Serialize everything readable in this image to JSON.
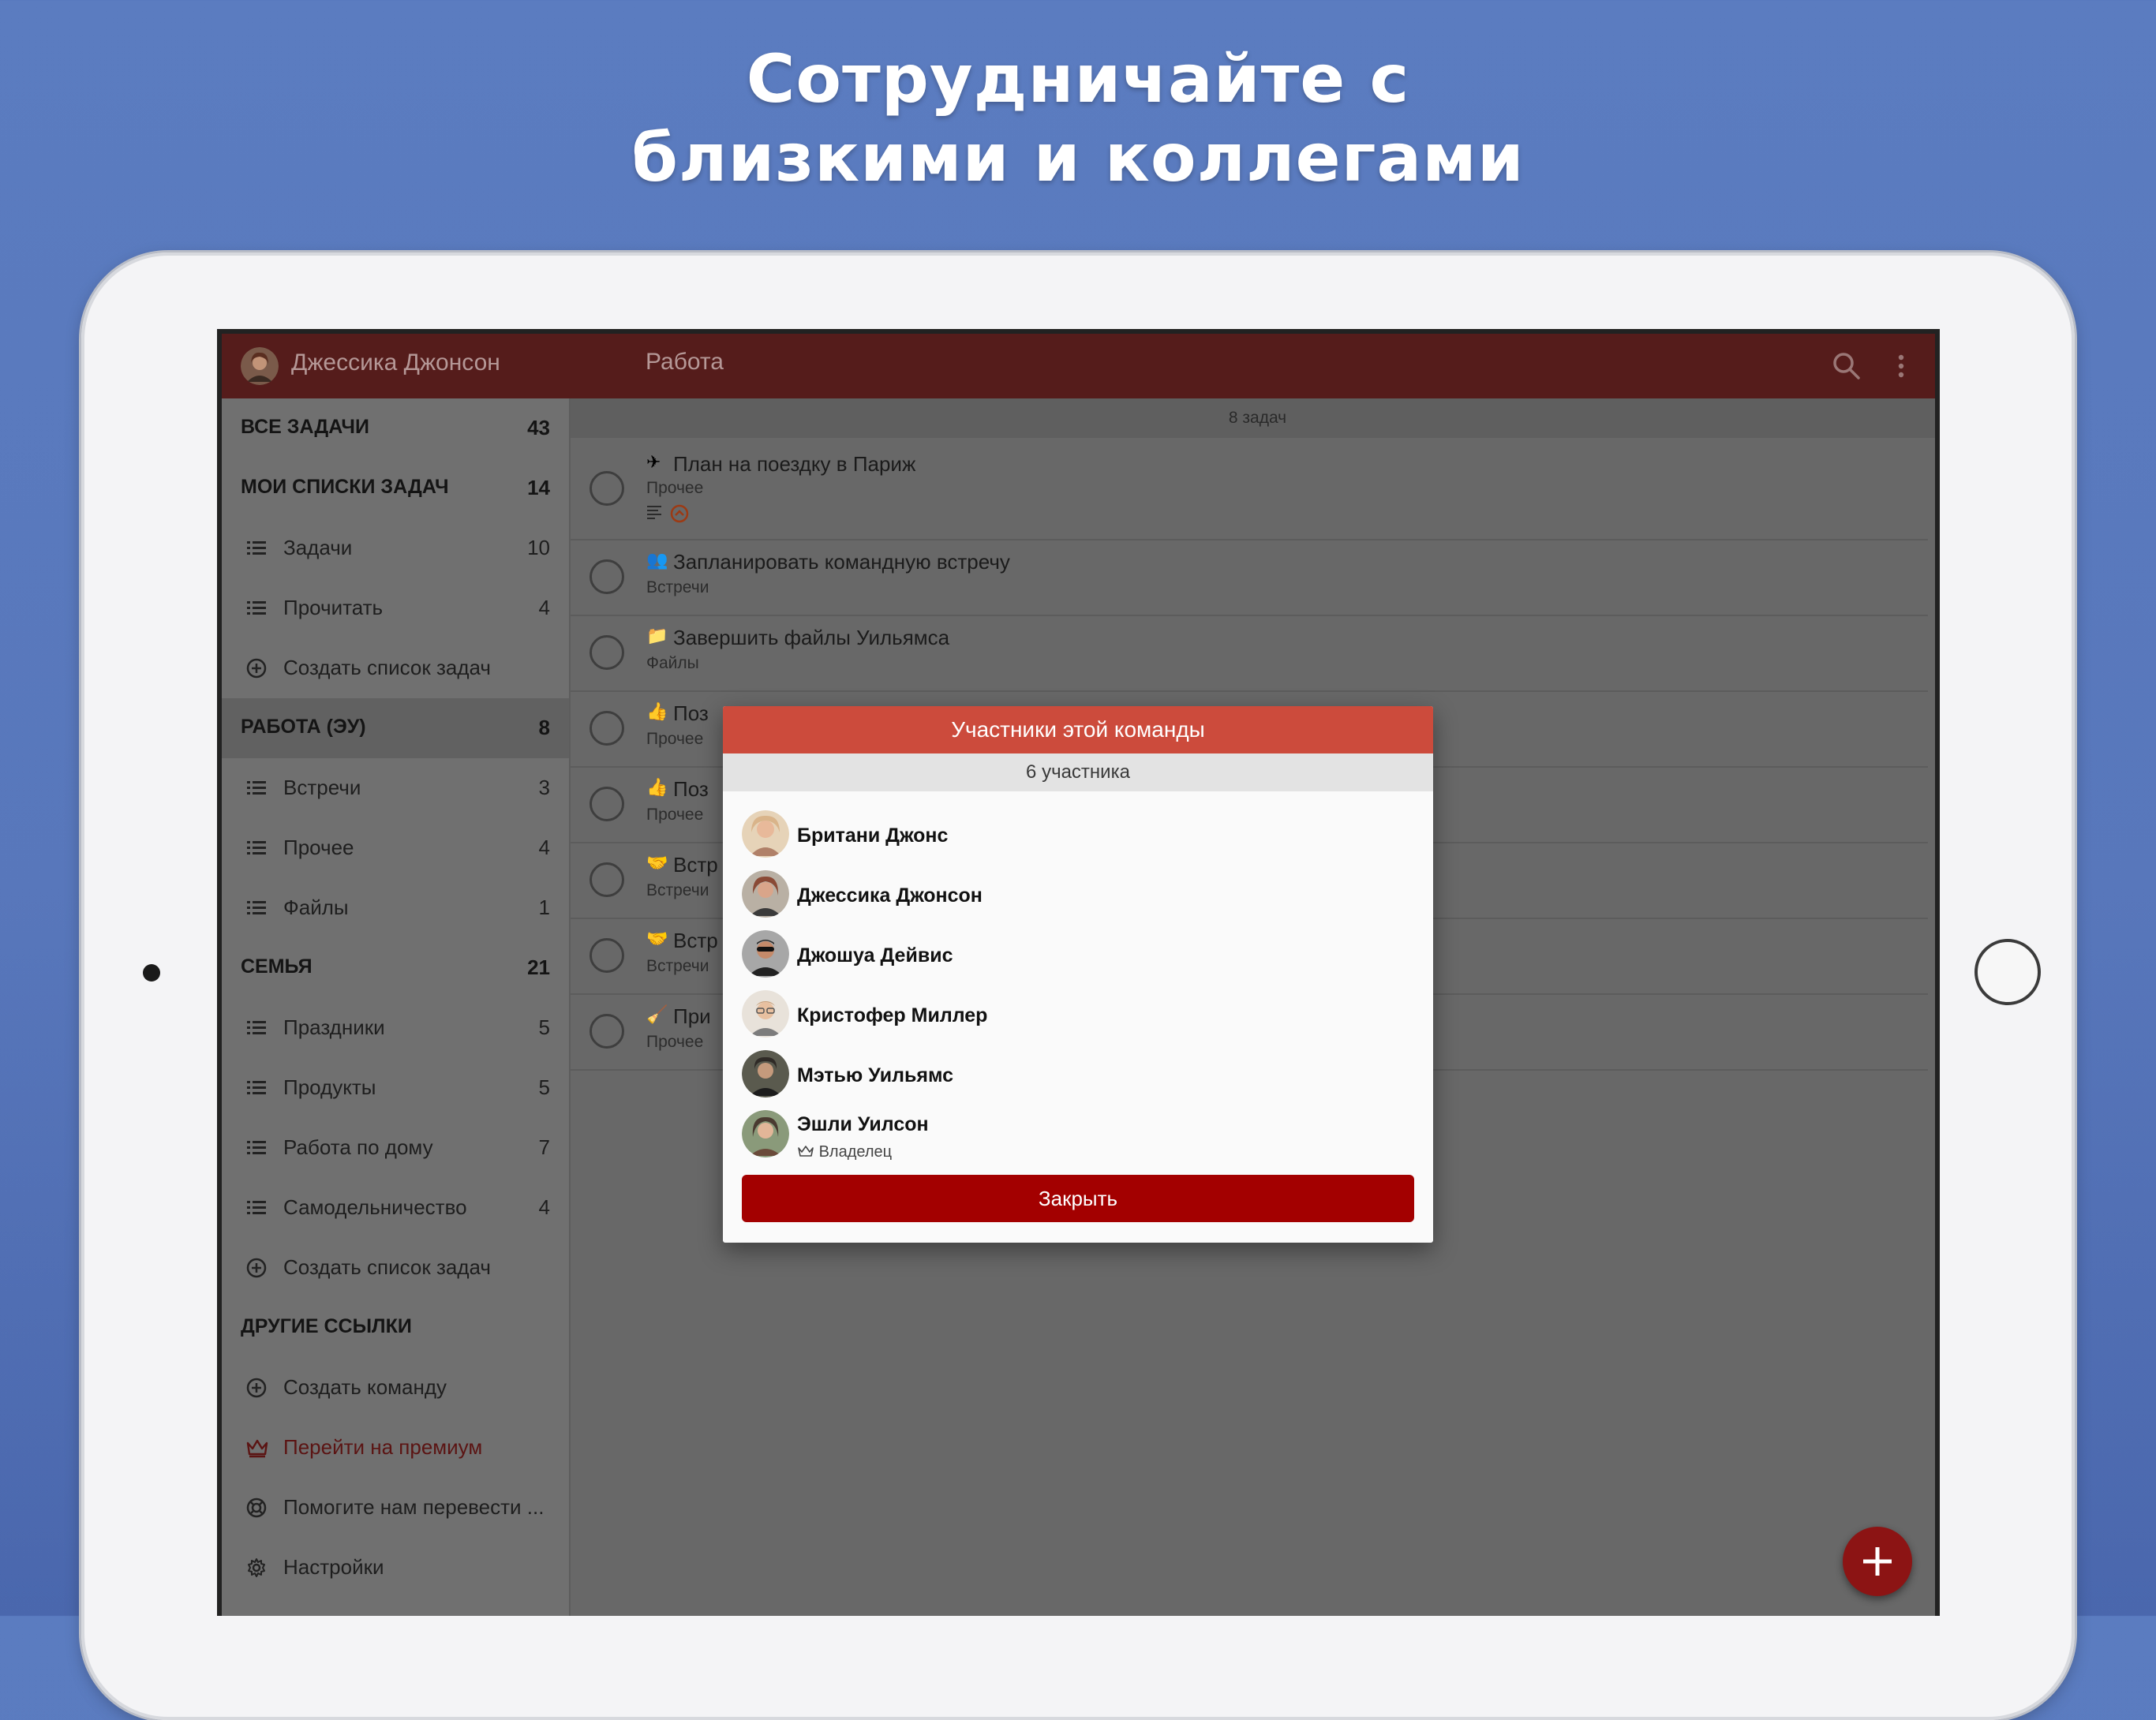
{
  "headline": {
    "line1": "Сотрудничайте с",
    "line2": "близкими и коллегами"
  },
  "topbar": {
    "user_name": "Джессика Джонсон",
    "list_title": "Работа"
  },
  "sidebar": {
    "all_tasks": {
      "label": "ВСЕ ЗАДАЧИ",
      "count": "43"
    },
    "my_lists": {
      "label": "МОИ СПИСКИ ЗАДАЧ",
      "count": "14"
    },
    "my_list_items": [
      {
        "label": "Задачи",
        "count": "10"
      },
      {
        "label": "Прочитать",
        "count": "4"
      }
    ],
    "create_list_1": "Создать список задач",
    "work": {
      "label": "РАБОТА (ЭУ)",
      "count": "8"
    },
    "work_items": [
      {
        "label": "Встречи",
        "count": "3"
      },
      {
        "label": "Прочее",
        "count": "4"
      },
      {
        "label": "Файлы",
        "count": "1"
      }
    ],
    "family": {
      "label": "СЕМЬЯ",
      "count": "21"
    },
    "family_items": [
      {
        "label": "Праздники",
        "count": "5"
      },
      {
        "label": "Продукты",
        "count": "5"
      },
      {
        "label": "Работа по дому",
        "count": "7"
      },
      {
        "label": "Самодельничество",
        "count": "4"
      }
    ],
    "create_list_2": "Создать список задач",
    "other_links": "ДРУГИЕ ССЫЛКИ",
    "create_team": "Создать команду",
    "premium": "Перейти на премиум",
    "translate": "Помогите нам перевести ...",
    "settings": "Настройки"
  },
  "main": {
    "task_count": "8 задач",
    "tasks": [
      {
        "title": "План на поездку в Париж",
        "list": "Прочее",
        "icon": "plane-icon"
      },
      {
        "title": "Запланировать командную встречу",
        "list": "Встречи",
        "icon": "people-icon"
      },
      {
        "title": "Завершить файлы Уильямса",
        "list": "Файлы",
        "icon": "folder-icon"
      },
      {
        "title": "Поз",
        "list": "Прочее",
        "icon": "thumbs-up-icon"
      },
      {
        "title": "Поз",
        "list": "Прочее",
        "icon": "thumbs-up-icon"
      },
      {
        "title": "Встр",
        "list": "Встречи",
        "icon": "handshake-icon"
      },
      {
        "title": "Встр",
        "list": "Встречи",
        "icon": "handshake-icon"
      },
      {
        "title": "При",
        "list": "Прочее",
        "icon": "broom-icon"
      }
    ]
  },
  "dialog": {
    "title": "Участники этой команды",
    "subtitle": "6 участника",
    "members": [
      {
        "name": "Британи Джонс",
        "avatar_color": "#d9b48a"
      },
      {
        "name": "Джессика Джонсон",
        "avatar_color": "#8a4a36"
      },
      {
        "name": "Джошуа Дейвис",
        "avatar_color": "#3b3b3b"
      },
      {
        "name": "Кристофер Миллер",
        "avatar_color": "#c9a07a"
      },
      {
        "name": "Мэтью Уильямс",
        "avatar_color": "#2f2a26"
      },
      {
        "name": "Эшли Уилсон",
        "role": "Владелец",
        "avatar_color": "#4a3a30"
      }
    ],
    "close_label": "Закрыть"
  },
  "colors": {
    "topbar": "#551c1b",
    "dialog_header": "#cc4b3c",
    "close_button": "#a30000",
    "fab": "#8c1414",
    "background": "#5b7cc0"
  }
}
